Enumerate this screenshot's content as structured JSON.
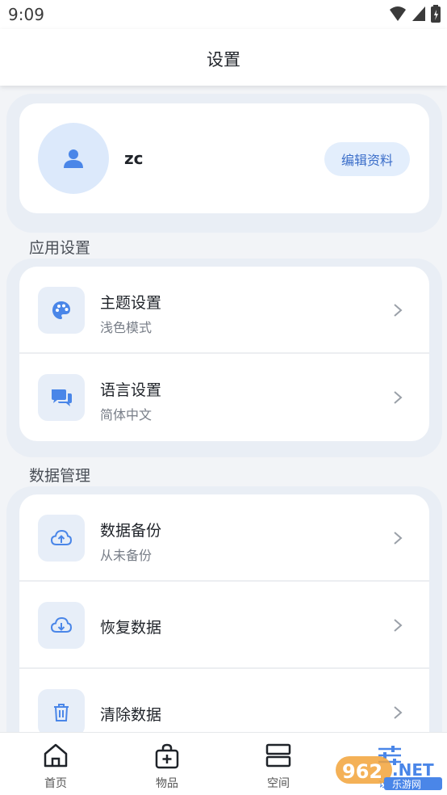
{
  "status_bar": {
    "time": "9:09"
  },
  "header": {
    "title": "设置"
  },
  "profile": {
    "username": "zc",
    "edit_label": "编辑资料"
  },
  "sections": {
    "app_settings": {
      "title": "应用设置",
      "items": [
        {
          "title": "主题设置",
          "subtitle": "浅色模式",
          "icon": "palette-icon"
        },
        {
          "title": "语言设置",
          "subtitle": "简体中文",
          "icon": "chat-bubbles-icon"
        }
      ]
    },
    "data_management": {
      "title": "数据管理",
      "items": [
        {
          "title": "数据备份",
          "subtitle": "从未备份",
          "icon": "cloud-upload-icon"
        },
        {
          "title": "恢复数据",
          "subtitle": "",
          "icon": "cloud-download-icon"
        },
        {
          "title": "清除数据",
          "subtitle": "",
          "icon": "trash-icon"
        }
      ]
    }
  },
  "bottom_nav": {
    "items": [
      {
        "label": "首页",
        "icon": "home-icon"
      },
      {
        "label": "物品",
        "icon": "bag-plus-icon"
      },
      {
        "label": "空间",
        "icon": "space-icon"
      },
      {
        "label": "设置",
        "icon": "sliders-icon"
      }
    ]
  },
  "watermark": {
    "text": "962.NET",
    "subtext": "乐游网"
  },
  "colors": {
    "accent": "#4a86e8",
    "accent_light": "#dce9fb",
    "background": "#f2f4f7",
    "card_outline": "#e9eef5"
  }
}
